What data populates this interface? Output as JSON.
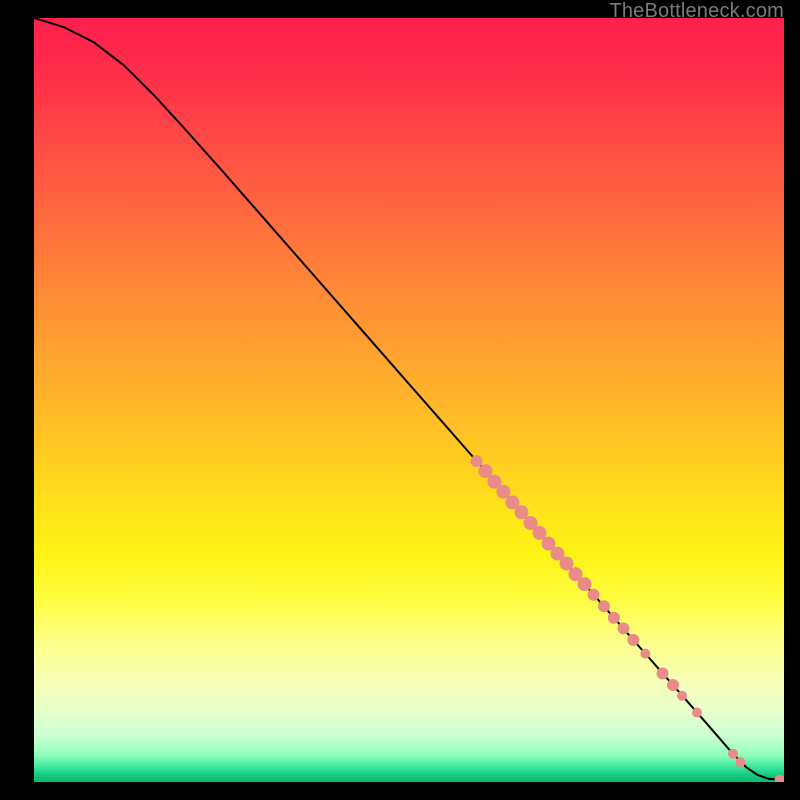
{
  "watermark": "TheBottleneck.com",
  "colors": {
    "line": "#000000",
    "marker_fill": "#e98b88",
    "marker_stroke": "#c96765",
    "background_black": "#000000"
  },
  "chart_data": {
    "type": "line",
    "title": "",
    "xlabel": "",
    "ylabel": "",
    "xlim": [
      0,
      100
    ],
    "ylim": [
      0,
      100
    ],
    "grid": false,
    "curve": [
      {
        "x": 0,
        "y": 100.0
      },
      {
        "x": 4,
        "y": 98.8
      },
      {
        "x": 8,
        "y": 96.8
      },
      {
        "x": 12,
        "y": 93.8
      },
      {
        "x": 16,
        "y": 89.9
      },
      {
        "x": 20,
        "y": 85.6
      },
      {
        "x": 25,
        "y": 80.1
      },
      {
        "x": 30,
        "y": 74.5
      },
      {
        "x": 35,
        "y": 68.9
      },
      {
        "x": 40,
        "y": 63.3
      },
      {
        "x": 45,
        "y": 57.7
      },
      {
        "x": 50,
        "y": 52.1
      },
      {
        "x": 55,
        "y": 46.5
      },
      {
        "x": 60,
        "y": 40.9
      },
      {
        "x": 65,
        "y": 35.3
      },
      {
        "x": 70,
        "y": 29.7
      },
      {
        "x": 75,
        "y": 24.1
      },
      {
        "x": 80,
        "y": 18.5
      },
      {
        "x": 85,
        "y": 12.9
      },
      {
        "x": 90,
        "y": 7.3
      },
      {
        "x": 93,
        "y": 3.9
      },
      {
        "x": 95,
        "y": 1.9
      },
      {
        "x": 96.5,
        "y": 0.9
      },
      {
        "x": 98,
        "y": 0.4
      },
      {
        "x": 100,
        "y": 0.3
      }
    ],
    "markers": [
      {
        "x": 59.0,
        "y": 42.0,
        "r": 6
      },
      {
        "x": 60.2,
        "y": 40.7,
        "r": 7
      },
      {
        "x": 61.4,
        "y": 39.3,
        "r": 7
      },
      {
        "x": 62.6,
        "y": 38.0,
        "r": 7
      },
      {
        "x": 63.8,
        "y": 36.6,
        "r": 7
      },
      {
        "x": 65.0,
        "y": 35.3,
        "r": 7
      },
      {
        "x": 66.2,
        "y": 33.9,
        "r": 7
      },
      {
        "x": 67.4,
        "y": 32.6,
        "r": 7
      },
      {
        "x": 68.6,
        "y": 31.2,
        "r": 7
      },
      {
        "x": 69.8,
        "y": 29.9,
        "r": 7
      },
      {
        "x": 71.0,
        "y": 28.6,
        "r": 7
      },
      {
        "x": 72.2,
        "y": 27.2,
        "r": 7
      },
      {
        "x": 73.4,
        "y": 25.9,
        "r": 7
      },
      {
        "x": 74.6,
        "y": 24.5,
        "r": 6
      },
      {
        "x": 76.0,
        "y": 23.0,
        "r": 6
      },
      {
        "x": 77.3,
        "y": 21.5,
        "r": 6
      },
      {
        "x": 78.6,
        "y": 20.1,
        "r": 6
      },
      {
        "x": 79.9,
        "y": 18.6,
        "r": 6
      },
      {
        "x": 81.5,
        "y": 16.8,
        "r": 5
      },
      {
        "x": 83.8,
        "y": 14.2,
        "r": 6
      },
      {
        "x": 85.2,
        "y": 12.7,
        "r": 6
      },
      {
        "x": 86.4,
        "y": 11.3,
        "r": 5
      },
      {
        "x": 88.4,
        "y": 9.1,
        "r": 5
      },
      {
        "x": 93.2,
        "y": 3.7,
        "r": 5
      },
      {
        "x": 94.2,
        "y": 2.6,
        "r": 5
      },
      {
        "x": 99.4,
        "y": 0.3,
        "r": 5
      }
    ]
  }
}
